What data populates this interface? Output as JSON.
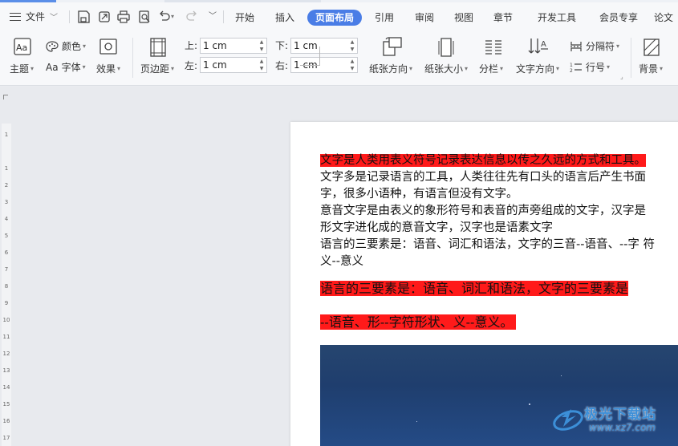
{
  "menubar": {
    "file_label": "文件",
    "tabs": [
      {
        "label": "开始",
        "active": false
      },
      {
        "label": "插入",
        "active": false
      },
      {
        "label": "页面布局",
        "active": true
      },
      {
        "label": "引用",
        "active": false
      },
      {
        "label": "审阅",
        "active": false
      },
      {
        "label": "视图",
        "active": false
      },
      {
        "label": "章节",
        "active": false
      },
      {
        "label": "开发工具",
        "active": false
      },
      {
        "label": "会员专享",
        "active": false
      },
      {
        "label": "论文",
        "active": false
      }
    ],
    "quick_access_icons": [
      "save-icon",
      "export-icon",
      "print-icon",
      "print-preview-icon",
      "undo-icon",
      "redo-icon",
      "customize-icon"
    ]
  },
  "ribbon": {
    "theme_label": "主题",
    "color_label": "颜色",
    "font_label": "字体",
    "effect_label": "效果",
    "margin_label": "页边距",
    "top_label": "上:",
    "top_value": "1 cm",
    "bottom_label": "下:",
    "bottom_value": "1 cm",
    "left_label": "左:",
    "left_value": "1 cm",
    "right_label": "右:",
    "right_value": "1 cm",
    "orientation_label": "纸张方向",
    "size_label": "纸张大小",
    "columns_label": "分栏",
    "text_direction_label": "文字方向",
    "breaks_label": "分隔符",
    "line_numbers_label": "行号",
    "background_label": "背景"
  },
  "ruler": {
    "top_tick": "1",
    "ticks": [
      "1",
      "2",
      "3",
      "4",
      "5",
      "6",
      "7",
      "8",
      "9",
      "10",
      "11",
      "12",
      "13",
      "14",
      "15",
      "16",
      "17"
    ]
  },
  "document": {
    "line1": "文字是人类用表义符号记录表达信息以传之久远的方式和工具。",
    "line2": "文字多是记录语言的工具，人类往往先有口头的语言后产生书面",
    "line3": "字，很多小语种，有语言但没有文字。",
    "line4": "意音文字是由表义的象形符号和表音的声旁组成的文字，汉字是",
    "line5": "形文字进化成的意音文字，汉字也是语素文字",
    "line6": "语言的三要素是：语音、词汇和语法，文字的三音--语音、--字 符",
    "line7": "义--意义",
    "line8": "语言的三要素是：语音、词汇和语法，文字的三要素是",
    "line9": "--语音、形--字符形状、义--意义。"
  },
  "watermark": {
    "name": "极光下载站",
    "url": "www.xz7.com"
  },
  "colors": {
    "accent": "#4a7de6",
    "highlight": "#ff1a1a",
    "page": "#ffffff",
    "workspace": "#e8eaee"
  }
}
